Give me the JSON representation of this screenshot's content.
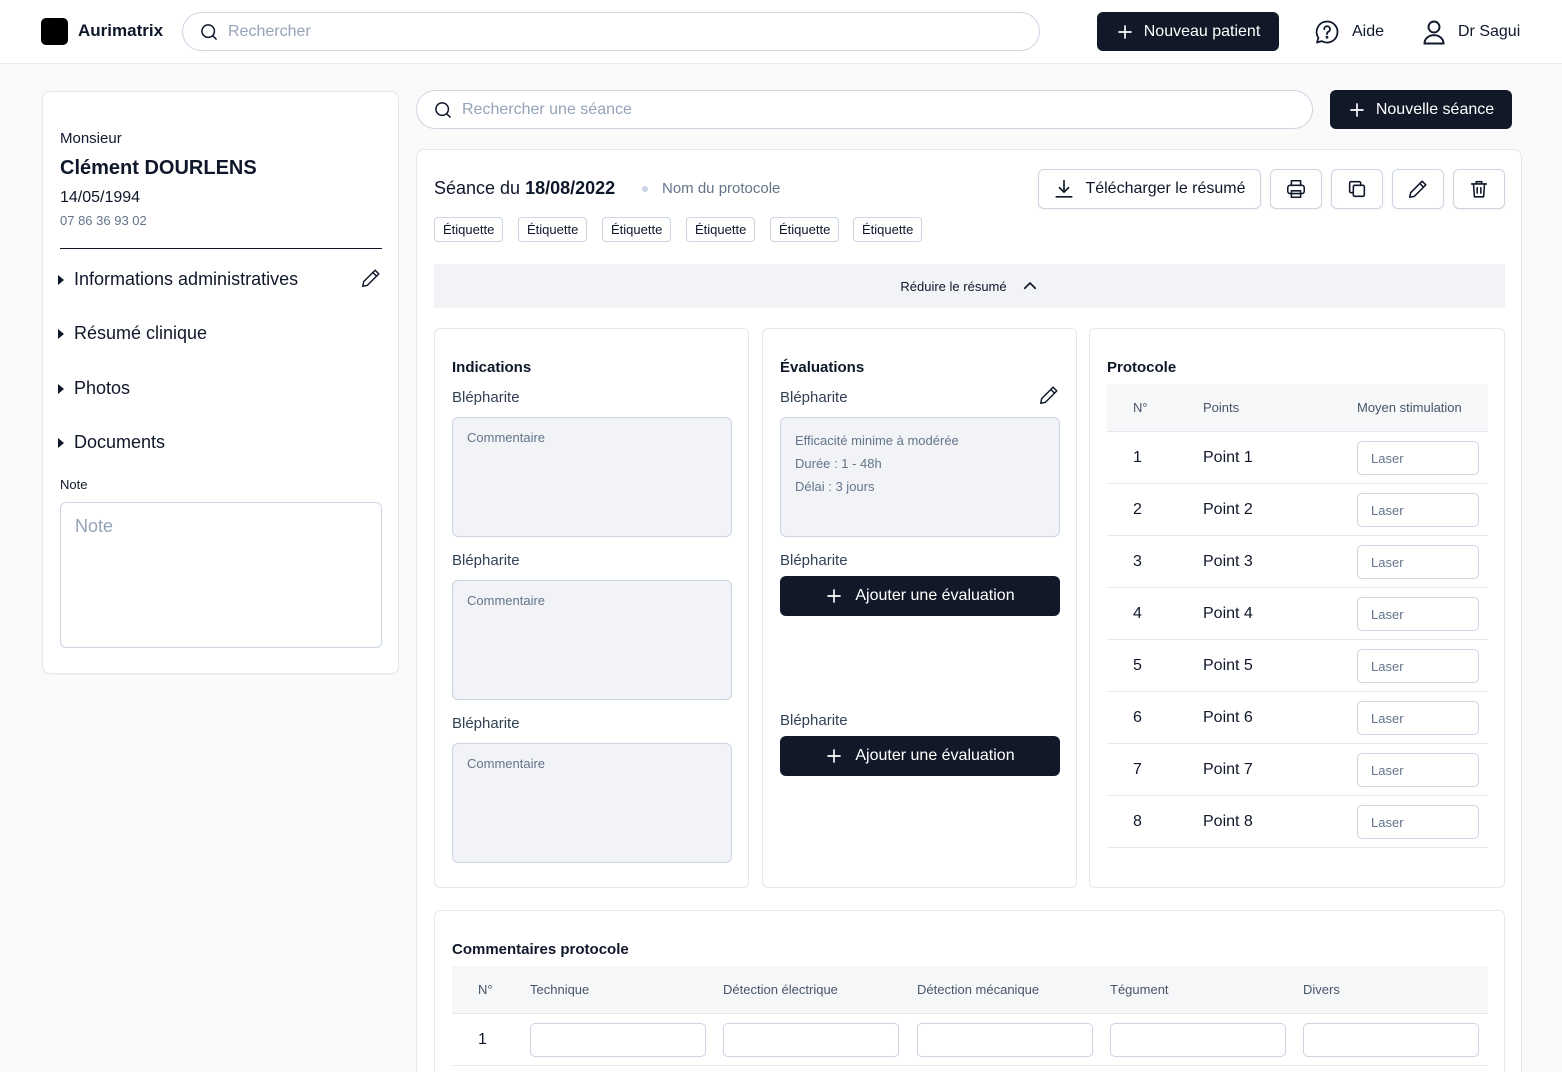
{
  "app": {
    "name": "Aurimatrix"
  },
  "topbar": {
    "search_placeholder": "Rechercher",
    "new_patient_label": "Nouveau patient",
    "help_label": "Aide",
    "user_label": "Dr Sagui"
  },
  "patient": {
    "title": "Monsieur",
    "name": "Clément DOURLENS",
    "dob": "14/05/1994",
    "phone": "07 86 36 93 02",
    "sections": [
      "Informations administratives",
      "Résumé clinique",
      "Photos",
      "Documents"
    ],
    "note_label": "Note",
    "note_placeholder": "Note"
  },
  "session_search_placeholder": "Rechercher une séance",
  "new_session_label": "Nouvelle séance",
  "session": {
    "title_prefix": "Séance du",
    "date": "18/08/2022",
    "protocol_name": "Nom du protocole",
    "download_label": "Télécharger le résumé",
    "tags": [
      "Étiquette",
      "Étiquette",
      "Étiquette",
      "Étiquette",
      "Étiquette",
      "Étiquette"
    ],
    "reduce_label": "Réduire le résumé"
  },
  "indications": {
    "heading": "Indications",
    "items": [
      {
        "label": "Blépharite",
        "placeholder": "Commentaire"
      },
      {
        "label": "Blépharite",
        "placeholder": "Commentaire"
      },
      {
        "label": "Blépharite",
        "placeholder": "Commentaire"
      }
    ]
  },
  "evaluations": {
    "heading": "Évaluations",
    "items": [
      {
        "label": "Blépharite",
        "lines": [
          "Efficacité minime à modérée",
          "Durée : 1 - 48h",
          "Délai : 3 jours"
        ]
      },
      {
        "label": "Blépharite",
        "button": "Ajouter une évaluation"
      },
      {
        "label": "Blépharite",
        "button": "Ajouter une évaluation"
      }
    ]
  },
  "protocol": {
    "heading": "Protocole",
    "columns": [
      "N°",
      "Points",
      "Moyen stimulation"
    ],
    "rows": [
      {
        "n": "1",
        "point": "Point 1",
        "placeholder": "Laser"
      },
      {
        "n": "2",
        "point": "Point 2",
        "placeholder": "Laser"
      },
      {
        "n": "3",
        "point": "Point 3",
        "placeholder": "Laser"
      },
      {
        "n": "4",
        "point": "Point 4",
        "placeholder": "Laser"
      },
      {
        "n": "5",
        "point": "Point 5",
        "placeholder": "Laser"
      },
      {
        "n": "6",
        "point": "Point 6",
        "placeholder": "Laser"
      },
      {
        "n": "7",
        "point": "Point 7",
        "placeholder": "Laser"
      },
      {
        "n": "8",
        "point": "Point 8",
        "placeholder": "Laser"
      }
    ]
  },
  "protocol_comments": {
    "heading": "Commentaires protocole",
    "columns": [
      "N°",
      "Technique",
      "Détection électrique",
      "Détection mécanique",
      "Tégument",
      "Divers"
    ],
    "rows": [
      {
        "n": "1"
      }
    ]
  },
  "colors": {
    "primary": "#111827",
    "border": "#cbd5e1",
    "muted": "#64748b",
    "field_bg": "#f1f3f6"
  }
}
